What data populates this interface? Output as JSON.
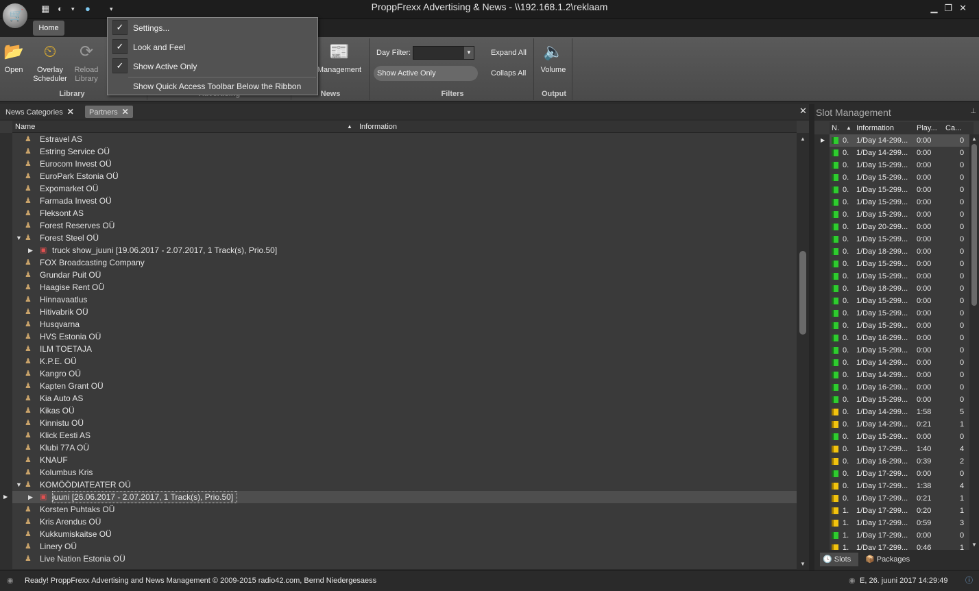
{
  "window": {
    "title": "ProppFrexx Advertising & News - \\\\192.168.1.2\\reklaam",
    "minimize_icon": "minimize-icon",
    "maximize_icon": "restore-icon",
    "close_icon": "close-icon"
  },
  "ribbon": {
    "home_tab": "Home",
    "open": "Open",
    "overlay_scheduler": "Overlay Scheduler",
    "reload_library": "Reload Library",
    "group_library": "Library",
    "group_advertising": "Advertising",
    "management": "Management",
    "group_news": "News",
    "day_filter_label": "Day Filter:",
    "show_active_only": "Show Active Only",
    "expand_all": "Expand All",
    "collaps_all": "Collaps All",
    "group_filters": "Filters",
    "volume": "Volume",
    "group_output": "Output"
  },
  "qat_menu": {
    "items": [
      "Settings...",
      "Look and Feel",
      "Show Active Only"
    ],
    "bottom_item": "Show Quick Access Toolbar Below the Ribbon"
  },
  "doc_tabs": [
    "News Categories",
    "Partners"
  ],
  "grid": {
    "col_name": "Name",
    "col_info": "Information",
    "rows": [
      {
        "label": "Estravel AS",
        "level": 0
      },
      {
        "label": "Estring Service OÜ",
        "level": 0
      },
      {
        "label": "Eurocom Invest OÜ",
        "level": 0
      },
      {
        "label": "EuroPark Estonia OÜ",
        "level": 0
      },
      {
        "label": "Expomarket OÜ",
        "level": 0
      },
      {
        "label": "Farmada Invest OÜ",
        "level": 0
      },
      {
        "label": "Fleksont AS",
        "level": 0
      },
      {
        "label": "Forest Reserves OÜ",
        "level": 0
      },
      {
        "label": "Forest Steel OÜ",
        "level": 0,
        "expanded": true
      },
      {
        "label": "truck show_juuni [19.06.2017 - 2.07.2017, 1 Track(s), Prio.50]",
        "level": 1
      },
      {
        "label": "FOX Broadcasting Company",
        "level": 0
      },
      {
        "label": "Grundar Puit OÜ",
        "level": 0
      },
      {
        "label": "Haagise Rent OÜ",
        "level": 0
      },
      {
        "label": "Hinnavaatlus",
        "level": 0
      },
      {
        "label": "Hitivabrik OÜ",
        "level": 0
      },
      {
        "label": "Husqvarna",
        "level": 0
      },
      {
        "label": "HVS Estonia OÜ",
        "level": 0
      },
      {
        "label": "ILM TOETAJA",
        "level": 0
      },
      {
        "label": "K.P.E. OÜ",
        "level": 0
      },
      {
        "label": "Kangro OÜ",
        "level": 0
      },
      {
        "label": "Kapten Grant OÜ",
        "level": 0
      },
      {
        "label": "Kia Auto AS",
        "level": 0
      },
      {
        "label": "Kikas OÜ",
        "level": 0
      },
      {
        "label": "Kinnistu OÜ",
        "level": 0
      },
      {
        "label": "Klick Eesti AS",
        "level": 0
      },
      {
        "label": "Klubi 77A OÜ",
        "level": 0
      },
      {
        "label": "KNAUF",
        "level": 0
      },
      {
        "label": "Kolumbus Kris",
        "level": 0
      },
      {
        "label": "KOMÖÖDIATEATER OÜ",
        "level": 0,
        "expanded": true
      },
      {
        "label": "juuni [26.06.2017 - 2.07.2017, 1 Track(s), Prio.50]",
        "level": 1,
        "selected": true
      },
      {
        "label": "Korsten Puhtaks OÜ",
        "level": 0
      },
      {
        "label": "Kris Arendus OÜ",
        "level": 0
      },
      {
        "label": "Kukkumiskaitse OÜ",
        "level": 0
      },
      {
        "label": "Linery OÜ",
        "level": 0
      },
      {
        "label": "Live Nation Estonia OÜ",
        "level": 0
      }
    ]
  },
  "slots": {
    "title": "Slot Management",
    "col_n": "N.",
    "col_info": "Information",
    "col_play": "Play...",
    "col_ca": "Ca...",
    "rows": [
      {
        "n": "0.",
        "info": "1/Day 14-299...",
        "play": "0:00",
        "ca": "0",
        "flag": "green"
      },
      {
        "n": "0.",
        "info": "1/Day 14-299...",
        "play": "0:00",
        "ca": "0",
        "flag": "green"
      },
      {
        "n": "0.",
        "info": "1/Day 15-299...",
        "play": "0:00",
        "ca": "0",
        "flag": "green"
      },
      {
        "n": "0.",
        "info": "1/Day 15-299...",
        "play": "0:00",
        "ca": "0",
        "flag": "green"
      },
      {
        "n": "0.",
        "info": "1/Day 15-299...",
        "play": "0:00",
        "ca": "0",
        "flag": "green"
      },
      {
        "n": "0.",
        "info": "1/Day 15-299...",
        "play": "0:00",
        "ca": "0",
        "flag": "green"
      },
      {
        "n": "0.",
        "info": "1/Day 15-299...",
        "play": "0:00",
        "ca": "0",
        "flag": "green"
      },
      {
        "n": "0.",
        "info": "1/Day 20-299...",
        "play": "0:00",
        "ca": "0",
        "flag": "green"
      },
      {
        "n": "0.",
        "info": "1/Day 15-299...",
        "play": "0:00",
        "ca": "0",
        "flag": "green"
      },
      {
        "n": "0.",
        "info": "1/Day 18-299...",
        "play": "0:00",
        "ca": "0",
        "flag": "green"
      },
      {
        "n": "0.",
        "info": "1/Day 15-299...",
        "play": "0:00",
        "ca": "0",
        "flag": "green"
      },
      {
        "n": "0.",
        "info": "1/Day 15-299...",
        "play": "0:00",
        "ca": "0",
        "flag": "green"
      },
      {
        "n": "0.",
        "info": "1/Day 18-299...",
        "play": "0:00",
        "ca": "0",
        "flag": "green"
      },
      {
        "n": "0.",
        "info": "1/Day 15-299...",
        "play": "0:00",
        "ca": "0",
        "flag": "green"
      },
      {
        "n": "0.",
        "info": "1/Day 15-299...",
        "play": "0:00",
        "ca": "0",
        "flag": "green"
      },
      {
        "n": "0.",
        "info": "1/Day 15-299...",
        "play": "0:00",
        "ca": "0",
        "flag": "green"
      },
      {
        "n": "0.",
        "info": "1/Day 16-299...",
        "play": "0:00",
        "ca": "0",
        "flag": "green"
      },
      {
        "n": "0.",
        "info": "1/Day 15-299...",
        "play": "0:00",
        "ca": "0",
        "flag": "green"
      },
      {
        "n": "0.",
        "info": "1/Day 14-299...",
        "play": "0:00",
        "ca": "0",
        "flag": "green"
      },
      {
        "n": "0.",
        "info": "1/Day 14-299...",
        "play": "0:00",
        "ca": "0",
        "flag": "green"
      },
      {
        "n": "0.",
        "info": "1/Day 16-299...",
        "play": "0:00",
        "ca": "0",
        "flag": "green"
      },
      {
        "n": "0.",
        "info": "1/Day 15-299...",
        "play": "0:00",
        "ca": "0",
        "flag": "green"
      },
      {
        "n": "0.",
        "info": "1/Day 14-299...",
        "play": "1:58",
        "ca": "5",
        "flag": "yellow"
      },
      {
        "n": "0.",
        "info": "1/Day 14-299...",
        "play": "0:21",
        "ca": "1",
        "flag": "yellow"
      },
      {
        "n": "0.",
        "info": "1/Day 15-299...",
        "play": "0:00",
        "ca": "0",
        "flag": "green"
      },
      {
        "n": "0.",
        "info": "1/Day 17-299...",
        "play": "1:40",
        "ca": "4",
        "flag": "yellow"
      },
      {
        "n": "0.",
        "info": "1/Day 16-299...",
        "play": "0:39",
        "ca": "2",
        "flag": "yellow"
      },
      {
        "n": "0.",
        "info": "1/Day 17-299...",
        "play": "0:00",
        "ca": "0",
        "flag": "green"
      },
      {
        "n": "0.",
        "info": "1/Day 17-299...",
        "play": "1:38",
        "ca": "4",
        "flag": "yellow"
      },
      {
        "n": "0.",
        "info": "1/Day 17-299...",
        "play": "0:21",
        "ca": "1",
        "flag": "yellow"
      },
      {
        "n": "1.",
        "info": "1/Day 17-299...",
        "play": "0:20",
        "ca": "1",
        "flag": "yellow"
      },
      {
        "n": "1.",
        "info": "1/Day 17-299...",
        "play": "0:59",
        "ca": "3",
        "flag": "yellow"
      },
      {
        "n": "1.",
        "info": "1/Day 17-299...",
        "play": "0:00",
        "ca": "0",
        "flag": "green"
      },
      {
        "n": "1.",
        "info": "1/Day 17-299...",
        "play": "0:46",
        "ca": "1",
        "flag": "yellow"
      }
    ],
    "tab_slots": "Slots",
    "tab_packages": "Packages"
  },
  "status": {
    "text": "Ready!  ProppFrexx Advertising and News Management © 2009-2015 radio42.com, Bernd Niedergesaess",
    "datetime": "E, 26. juuni 2017 14:29:49"
  }
}
